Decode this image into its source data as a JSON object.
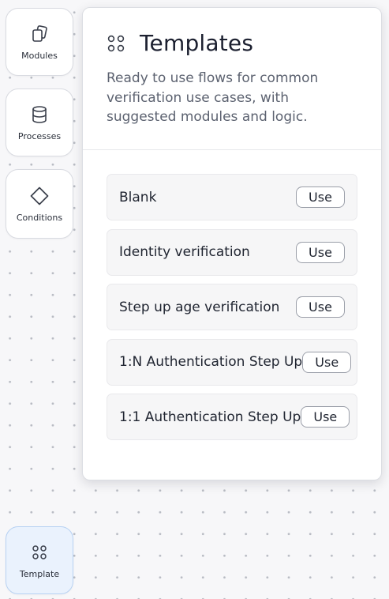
{
  "sidebar": {
    "items": [
      {
        "label": "Modules",
        "icon": "copy-icon"
      },
      {
        "label": "Processes",
        "icon": "database-icon"
      },
      {
        "label": "Conditions",
        "icon": "diamond-icon"
      },
      {
        "label": "Template",
        "icon": "four-dots-icon",
        "active": true
      }
    ]
  },
  "panel": {
    "title": "Templates",
    "title_icon": "four-dots-icon",
    "description": "Ready to use flows for common verification use cases, with suggested modules and logic.",
    "templates": [
      {
        "name": "Blank",
        "action": "Use"
      },
      {
        "name": "Identity verification",
        "action": "Use"
      },
      {
        "name": "Step up age verification",
        "action": "Use"
      },
      {
        "name": "1:N Authentication Step Up",
        "action": "Use"
      },
      {
        "name": "1:1 Authentication Step Up",
        "action": "Use"
      }
    ]
  },
  "colors": {
    "canvas_bg": "#f7f7f9",
    "active_bg": "#eaf2fd",
    "active_border": "#b8d2f3",
    "text": "#1f2430",
    "muted_text": "#5c6270"
  }
}
